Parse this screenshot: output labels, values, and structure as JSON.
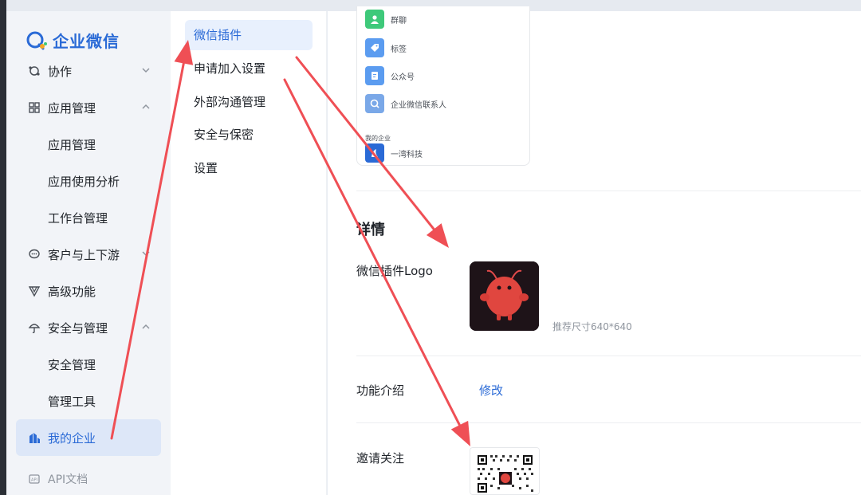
{
  "brand": {
    "name": "企业微信",
    "color": "#2a6ad6"
  },
  "sidebar": {
    "items": [
      {
        "label": "协作",
        "icon": "collaborate-icon",
        "chevron": "down",
        "level": 1
      },
      {
        "label": "应用管理",
        "icon": "apps-grid-icon",
        "chevron": "up",
        "level": 1
      },
      {
        "label": "应用管理",
        "level": 2
      },
      {
        "label": "应用使用分析",
        "level": 2
      },
      {
        "label": "工作台管理",
        "level": 2
      },
      {
        "label": "客户与上下游",
        "icon": "chat-bubble-icon",
        "chevron": "down",
        "level": 1
      },
      {
        "label": "高级功能",
        "icon": "triangle-icon",
        "level": 1
      },
      {
        "label": "安全与管理",
        "icon": "umbrella-icon",
        "chevron": "up",
        "level": 1
      },
      {
        "label": "安全管理",
        "level": 2
      },
      {
        "label": "管理工具",
        "level": 2
      },
      {
        "label": "我的企业",
        "icon": "company-icon",
        "level": 1,
        "active": true
      },
      {
        "label": "API文档",
        "icon": "api-icon",
        "level": 1
      }
    ]
  },
  "submenu": {
    "items": [
      {
        "label": "微信插件",
        "active": true
      },
      {
        "label": "申请加入设置"
      },
      {
        "label": "外部沟通管理"
      },
      {
        "label": "安全与保密"
      },
      {
        "label": "设置"
      }
    ]
  },
  "preview": {
    "rows": [
      {
        "label": "群聊",
        "icon": "group-chat-icon",
        "color": "#3ec97a"
      },
      {
        "label": "标签",
        "icon": "tag-icon",
        "color": "#5b9cf0"
      },
      {
        "label": "公众号",
        "icon": "official-account-icon",
        "color": "#5b9cf0"
      },
      {
        "label": "企业微信联系人",
        "icon": "wework-contact-icon",
        "color": "#7aa8e8"
      }
    ],
    "section_label": "我的企业",
    "company": {
      "label": "一湾科技",
      "icon": "company-logo-icon",
      "color": "#2a6ad6"
    }
  },
  "details": {
    "title": "详情",
    "logo_label": "微信插件Logo",
    "logo_hint": "推荐尺寸640*640",
    "intro_label": "功能介绍",
    "intro_action": "修改",
    "follow_label": "邀请关注"
  },
  "annotation_color": "#ef4f55"
}
